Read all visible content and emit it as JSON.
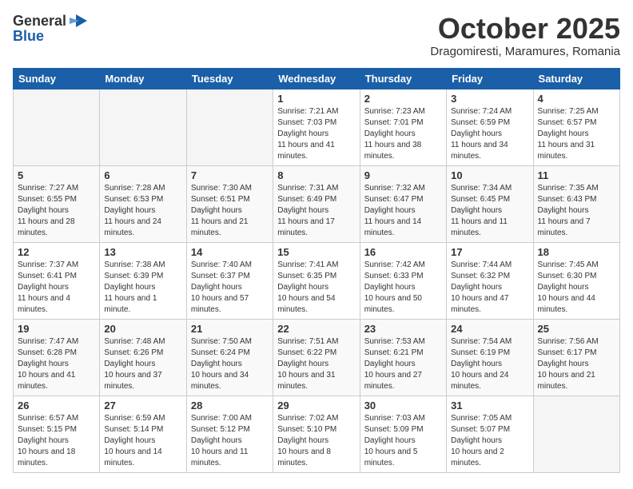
{
  "header": {
    "logo_general": "General",
    "logo_blue": "Blue",
    "month": "October 2025",
    "location": "Dragomiresti, Maramures, Romania"
  },
  "days_of_week": [
    "Sunday",
    "Monday",
    "Tuesday",
    "Wednesday",
    "Thursday",
    "Friday",
    "Saturday"
  ],
  "weeks": [
    [
      {
        "day": null
      },
      {
        "day": null
      },
      {
        "day": null
      },
      {
        "day": "1",
        "sunrise": "7:21 AM",
        "sunset": "7:03 PM",
        "daylight": "11 hours and 41 minutes."
      },
      {
        "day": "2",
        "sunrise": "7:23 AM",
        "sunset": "7:01 PM",
        "daylight": "11 hours and 38 minutes."
      },
      {
        "day": "3",
        "sunrise": "7:24 AM",
        "sunset": "6:59 PM",
        "daylight": "11 hours and 34 minutes."
      },
      {
        "day": "4",
        "sunrise": "7:25 AM",
        "sunset": "6:57 PM",
        "daylight": "11 hours and 31 minutes."
      }
    ],
    [
      {
        "day": "5",
        "sunrise": "7:27 AM",
        "sunset": "6:55 PM",
        "daylight": "11 hours and 28 minutes."
      },
      {
        "day": "6",
        "sunrise": "7:28 AM",
        "sunset": "6:53 PM",
        "daylight": "11 hours and 24 minutes."
      },
      {
        "day": "7",
        "sunrise": "7:30 AM",
        "sunset": "6:51 PM",
        "daylight": "11 hours and 21 minutes."
      },
      {
        "day": "8",
        "sunrise": "7:31 AM",
        "sunset": "6:49 PM",
        "daylight": "11 hours and 17 minutes."
      },
      {
        "day": "9",
        "sunrise": "7:32 AM",
        "sunset": "6:47 PM",
        "daylight": "11 hours and 14 minutes."
      },
      {
        "day": "10",
        "sunrise": "7:34 AM",
        "sunset": "6:45 PM",
        "daylight": "11 hours and 11 minutes."
      },
      {
        "day": "11",
        "sunrise": "7:35 AM",
        "sunset": "6:43 PM",
        "daylight": "11 hours and 7 minutes."
      }
    ],
    [
      {
        "day": "12",
        "sunrise": "7:37 AM",
        "sunset": "6:41 PM",
        "daylight": "11 hours and 4 minutes."
      },
      {
        "day": "13",
        "sunrise": "7:38 AM",
        "sunset": "6:39 PM",
        "daylight": "11 hours and 1 minute."
      },
      {
        "day": "14",
        "sunrise": "7:40 AM",
        "sunset": "6:37 PM",
        "daylight": "10 hours and 57 minutes."
      },
      {
        "day": "15",
        "sunrise": "7:41 AM",
        "sunset": "6:35 PM",
        "daylight": "10 hours and 54 minutes."
      },
      {
        "day": "16",
        "sunrise": "7:42 AM",
        "sunset": "6:33 PM",
        "daylight": "10 hours and 50 minutes."
      },
      {
        "day": "17",
        "sunrise": "7:44 AM",
        "sunset": "6:32 PM",
        "daylight": "10 hours and 47 minutes."
      },
      {
        "day": "18",
        "sunrise": "7:45 AM",
        "sunset": "6:30 PM",
        "daylight": "10 hours and 44 minutes."
      }
    ],
    [
      {
        "day": "19",
        "sunrise": "7:47 AM",
        "sunset": "6:28 PM",
        "daylight": "10 hours and 41 minutes."
      },
      {
        "day": "20",
        "sunrise": "7:48 AM",
        "sunset": "6:26 PM",
        "daylight": "10 hours and 37 minutes."
      },
      {
        "day": "21",
        "sunrise": "7:50 AM",
        "sunset": "6:24 PM",
        "daylight": "10 hours and 34 minutes."
      },
      {
        "day": "22",
        "sunrise": "7:51 AM",
        "sunset": "6:22 PM",
        "daylight": "10 hours and 31 minutes."
      },
      {
        "day": "23",
        "sunrise": "7:53 AM",
        "sunset": "6:21 PM",
        "daylight": "10 hours and 27 minutes."
      },
      {
        "day": "24",
        "sunrise": "7:54 AM",
        "sunset": "6:19 PM",
        "daylight": "10 hours and 24 minutes."
      },
      {
        "day": "25",
        "sunrise": "7:56 AM",
        "sunset": "6:17 PM",
        "daylight": "10 hours and 21 minutes."
      }
    ],
    [
      {
        "day": "26",
        "sunrise": "6:57 AM",
        "sunset": "5:15 PM",
        "daylight": "10 hours and 18 minutes."
      },
      {
        "day": "27",
        "sunrise": "6:59 AM",
        "sunset": "5:14 PM",
        "daylight": "10 hours and 14 minutes."
      },
      {
        "day": "28",
        "sunrise": "7:00 AM",
        "sunset": "5:12 PM",
        "daylight": "10 hours and 11 minutes."
      },
      {
        "day": "29",
        "sunrise": "7:02 AM",
        "sunset": "5:10 PM",
        "daylight": "10 hours and 8 minutes."
      },
      {
        "day": "30",
        "sunrise": "7:03 AM",
        "sunset": "5:09 PM",
        "daylight": "10 hours and 5 minutes."
      },
      {
        "day": "31",
        "sunrise": "7:05 AM",
        "sunset": "5:07 PM",
        "daylight": "10 hours and 2 minutes."
      },
      {
        "day": null
      }
    ]
  ]
}
